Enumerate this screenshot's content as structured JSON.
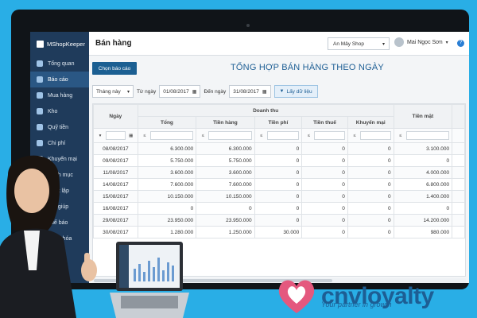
{
  "app": {
    "brand": "MShopKeeper"
  },
  "sidebar": {
    "items": [
      {
        "label": "Tổng quan",
        "icon": "dashboard-icon",
        "active": false
      },
      {
        "label": "Báo cáo",
        "icon": "report-icon",
        "active": true
      },
      {
        "label": "Mua hàng",
        "icon": "cart-icon",
        "active": false
      },
      {
        "label": "Kho",
        "icon": "warehouse-icon",
        "active": false
      },
      {
        "label": "Quỹ tiền",
        "icon": "cash-icon",
        "active": false
      },
      {
        "label": "Chi phí",
        "icon": "expense-icon",
        "active": false
      },
      {
        "label": "Khuyến mại",
        "icon": "promotion-icon",
        "active": false
      },
      {
        "label": "Danh mục",
        "icon": "catalog-icon",
        "active": false
      },
      {
        "label": "Thiết lập",
        "icon": "settings-icon",
        "active": false
      },
      {
        "label": "Trợ giúp",
        "icon": "help-icon",
        "active": false
      },
      {
        "label": "Tuế báo",
        "icon": "notice-icon",
        "active": false
      },
      {
        "label": "Hàng hóa",
        "icon": "goods-icon",
        "active": false
      }
    ]
  },
  "header": {
    "title": "Bán hàng",
    "shop": "An Mây Shop",
    "user": "Mai Ngọc Sơn",
    "help": "?"
  },
  "report": {
    "select_button": "Chọn báo cáo",
    "title": "TỔNG HỢP BÁN HÀNG THEO NGÀY"
  },
  "filters": {
    "period": "Tháng này",
    "from_label": "Từ ngày",
    "from_date": "01/08/2017",
    "to_label": "Đến ngày",
    "to_date": "31/08/2017",
    "get_data": "Lấy dữ liệu"
  },
  "table": {
    "date_header": "Ngày",
    "group_header": "Doanh thu",
    "columns": [
      "Tổng",
      "Tiền hàng",
      "Tiền phí",
      "Tiền thuế",
      "Khuyến mại",
      "Tiền mặt"
    ],
    "rows": [
      [
        "08/08/2017",
        "6.300.000",
        "6.300.000",
        "0",
        "0",
        "0",
        "3.100.000"
      ],
      [
        "09/08/2017",
        "5.750.000",
        "5.750.000",
        "0",
        "0",
        "0",
        "0"
      ],
      [
        "11/08/2017",
        "3.600.000",
        "3.600.000",
        "0",
        "0",
        "0",
        "4.000.000"
      ],
      [
        "14/08/2017",
        "7.600.000",
        "7.600.000",
        "0",
        "0",
        "0",
        "6.800.000"
      ],
      [
        "15/08/2017",
        "10.150.000",
        "10.150.000",
        "0",
        "0",
        "0",
        "1.400.000"
      ],
      [
        "16/08/2017",
        "0",
        "0",
        "0",
        "0",
        "0",
        "0"
      ],
      [
        "29/08/2017",
        "23.950.000",
        "23.950.000",
        "0",
        "0",
        "0",
        "14.200.000"
      ],
      [
        "30/08/2017",
        "1.280.000",
        "1.250.000",
        "30.000",
        "0",
        "0",
        "980.000"
      ]
    ]
  },
  "brand_overlay": {
    "name": "cnvloyalty",
    "tagline": "Your partner in growth",
    "accent": "#e4587e"
  }
}
